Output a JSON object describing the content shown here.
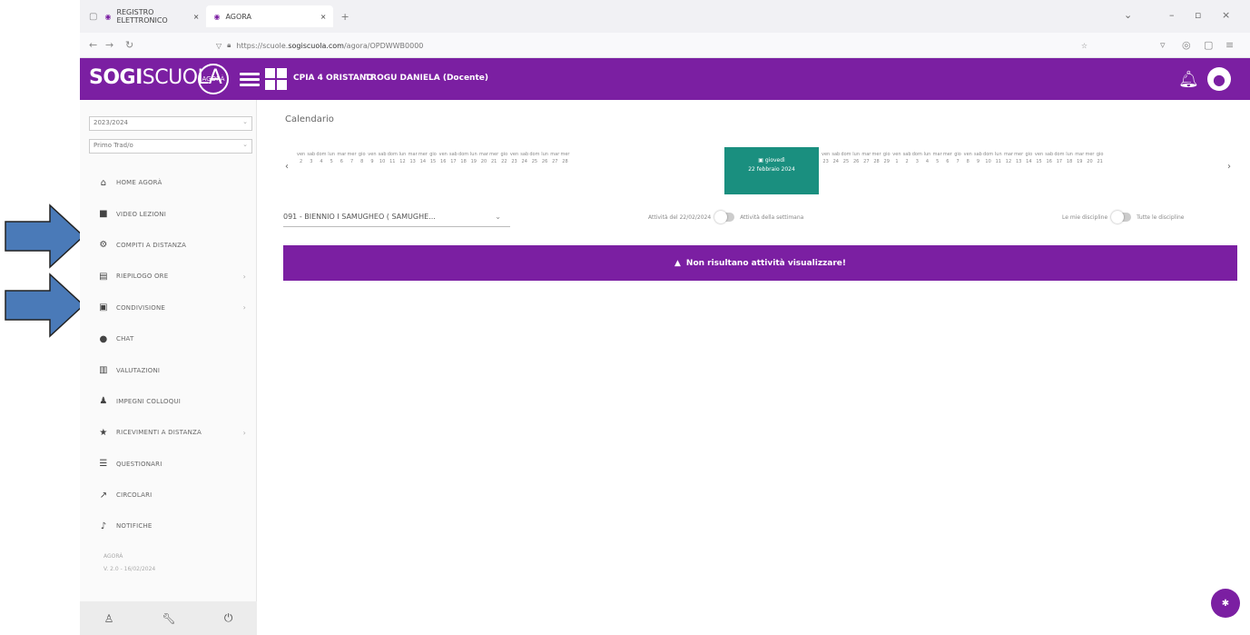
{
  "browser": {
    "tab1": "REGISTRO ELETTRONICO",
    "tab2": "AGORA",
    "url_host": "sogiscuola.com",
    "url_prefix": "https://scuole.",
    "url_path": "/agora/OPDWWB0000"
  },
  "header": {
    "logo_bold": "SOGI",
    "logo_light": "SCUOLA",
    "logo_badge": "AGORÀ",
    "school": "CPIA 4 ORISTANO",
    "user": "TROGU DANIELA (Docente)"
  },
  "sidebar": {
    "year": "2023/2024",
    "period": "Primo Trad/o",
    "items": [
      {
        "label": "HOME AGORÀ",
        "icon": "home-icon",
        "glyph": "⌂"
      },
      {
        "label": "VIDEO LEZIONI",
        "icon": "video-icon",
        "glyph": "■"
      },
      {
        "label": "COMPITI A DISTANZA",
        "icon": "tasks-icon",
        "glyph": "⚙"
      },
      {
        "label": "RIEPILOGO ORE",
        "icon": "file-icon",
        "glyph": "▤"
      },
      {
        "label": "CONDIVISIONE",
        "icon": "share-icon",
        "glyph": "▣"
      },
      {
        "label": "CHAT",
        "icon": "chat-icon",
        "glyph": "●"
      },
      {
        "label": "VALUTAZIONI",
        "icon": "clipboard-icon",
        "glyph": "▥"
      },
      {
        "label": "IMPEGNI COLLOQUI",
        "icon": "people-icon",
        "glyph": "♟"
      },
      {
        "label": "RICEVIMENTI A DISTANZA",
        "icon": "meeting-icon",
        "glyph": "★"
      },
      {
        "label": "QUESTIONARI",
        "icon": "list-icon",
        "glyph": "☰"
      },
      {
        "label": "CIRCOLARI",
        "icon": "export-icon",
        "glyph": "↗"
      },
      {
        "label": "NOTIFICHE",
        "icon": "bell-icon",
        "glyph": "♪"
      }
    ],
    "version_1": "AGORÀ",
    "version_2": "V. 2.0 - 16/02/2024"
  },
  "main": {
    "title": "Calendario",
    "days_before": [
      "ven",
      "sab",
      "dom",
      "lun",
      "mar",
      "mer",
      "gio",
      "ven",
      "sab",
      "dom",
      "lun",
      "mar",
      "mer",
      "gio",
      "ven",
      "sab",
      "dom",
      "lun",
      "mar",
      "mer",
      "gio",
      "ven",
      "sab",
      "dom",
      "lun",
      "mar",
      "mer"
    ],
    "nums_before": [
      "2",
      "3",
      "4",
      "5",
      "6",
      "7",
      "8",
      "9",
      "10",
      "11",
      "12",
      "13",
      "14",
      "15",
      "16",
      "17",
      "18",
      "19",
      "20",
      "21",
      "22",
      "23",
      "24",
      "25",
      "26",
      "27",
      "28"
    ],
    "today_label": "giovedì",
    "today_date": "22 febbraio 2024",
    "days_after": [
      "ven",
      "sab",
      "dom",
      "lun",
      "mar",
      "mer",
      "gio",
      "ven",
      "sab",
      "dom",
      "lun",
      "mar",
      "mer",
      "gio",
      "ven",
      "sab",
      "dom",
      "lun",
      "mar",
      "mer",
      "gio",
      "ven",
      "sab",
      "dom",
      "lun",
      "mar",
      "mer",
      "gio"
    ],
    "nums_after": [
      "23",
      "24",
      "25",
      "26",
      "27",
      "28",
      "29",
      "1",
      "2",
      "3",
      "4",
      "5",
      "6",
      "7",
      "8",
      "9",
      "10",
      "11",
      "12",
      "13",
      "14",
      "15",
      "16",
      "17",
      "18",
      "19",
      "20",
      "21"
    ],
    "class_select": "091 - BIENNIO I SAMUGHEO ( SAMUGHE...",
    "toggle1_left": "Attività del 22/02/2024",
    "toggle1_right": "Attività della settimana",
    "toggle2_left": "Le mie discipline",
    "toggle2_right": "Tutte le discipline",
    "banner": "Non risultano attività visualizzare!"
  },
  "colors": {
    "brand": "#7b1fa2",
    "today": "#1a8f7f",
    "arrow": "#4a7ab8"
  }
}
